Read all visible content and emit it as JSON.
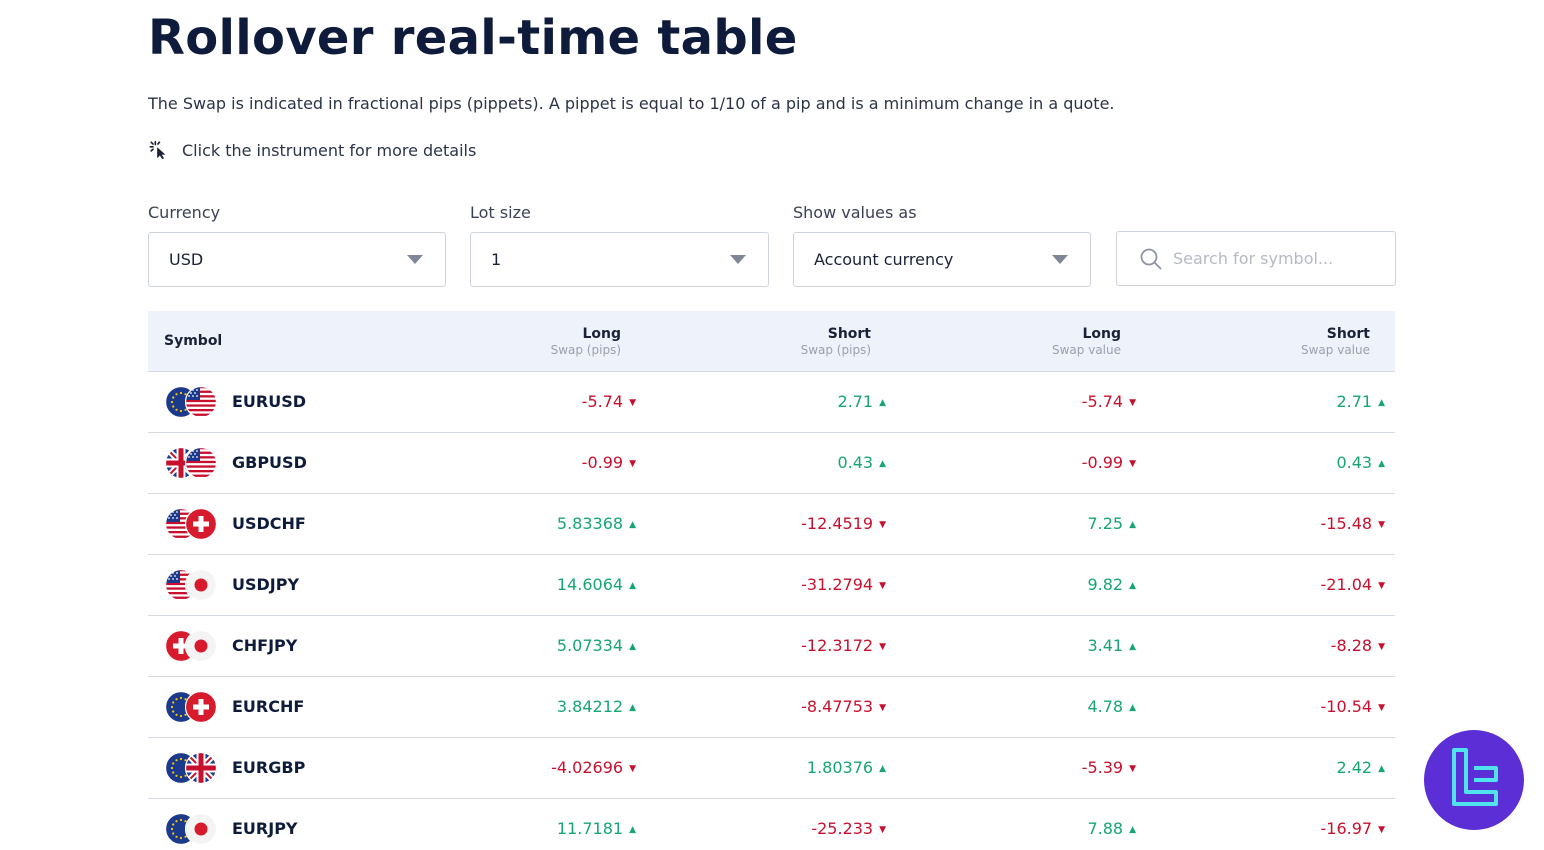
{
  "page": {
    "title": "Rollover real-time table",
    "intro": "The Swap is indicated in fractional pips (pippets). A pippet is equal to 1/10 of a pip and is a minimum change in a quote.",
    "hint": "Click the instrument for more details"
  },
  "filters": {
    "currency": {
      "label": "Currency",
      "value": "USD"
    },
    "lot_size": {
      "label": "Lot size",
      "value": "1"
    },
    "show_values": {
      "label": "Show values as",
      "value": "Account currency"
    },
    "search_placeholder": "Search for symbol..."
  },
  "table": {
    "headers": {
      "symbol": "Symbol",
      "long_pips": {
        "main": "Long",
        "sub": "Swap (pips)"
      },
      "short_pips": {
        "main": "Short",
        "sub": "Swap (pips)"
      },
      "long_value": {
        "main": "Long",
        "sub": "Swap value"
      },
      "short_value": {
        "main": "Short",
        "sub": "Swap value"
      }
    },
    "rows": [
      {
        "symbol": "EURUSD",
        "flags": [
          "eu",
          "us"
        ],
        "long_pips": "-5.74",
        "short_pips": "2.71",
        "long_value": "-5.74",
        "short_value": "2.71"
      },
      {
        "symbol": "GBPUSD",
        "flags": [
          "gb",
          "us"
        ],
        "long_pips": "-0.99",
        "short_pips": "0.43",
        "long_value": "-0.99",
        "short_value": "0.43"
      },
      {
        "symbol": "USDCHF",
        "flags": [
          "us",
          "ch"
        ],
        "long_pips": "5.83368",
        "short_pips": "-12.4519",
        "long_value": "7.25",
        "short_value": "-15.48"
      },
      {
        "symbol": "USDJPY",
        "flags": [
          "us",
          "jp"
        ],
        "long_pips": "14.6064",
        "short_pips": "-31.2794",
        "long_value": "9.82",
        "short_value": "-21.04"
      },
      {
        "symbol": "CHFJPY",
        "flags": [
          "ch",
          "jp"
        ],
        "long_pips": "5.07334",
        "short_pips": "-12.3172",
        "long_value": "3.41",
        "short_value": "-8.28"
      },
      {
        "symbol": "EURCHF",
        "flags": [
          "eu",
          "ch"
        ],
        "long_pips": "3.84212",
        "short_pips": "-8.47753",
        "long_value": "4.78",
        "short_value": "-10.54"
      },
      {
        "symbol": "EURGBP",
        "flags": [
          "eu",
          "gb"
        ],
        "long_pips": "-4.02696",
        "short_pips": "1.80376",
        "long_value": "-5.39",
        "short_value": "2.42"
      },
      {
        "symbol": "EURJPY",
        "flags": [
          "eu",
          "jp"
        ],
        "long_pips": "11.7181",
        "short_pips": "-25.233",
        "long_value": "7.88",
        "short_value": "-16.97"
      }
    ]
  },
  "icons": {
    "hint": "cursor-click-icon",
    "search": "search-icon",
    "caret": "chevron-down-icon",
    "badge": "brand-logo-icon"
  },
  "colors": {
    "positive": "#17a673",
    "negative": "#c8102e",
    "header_bg": "#eef2fb",
    "badge": "#5b2ed6"
  }
}
